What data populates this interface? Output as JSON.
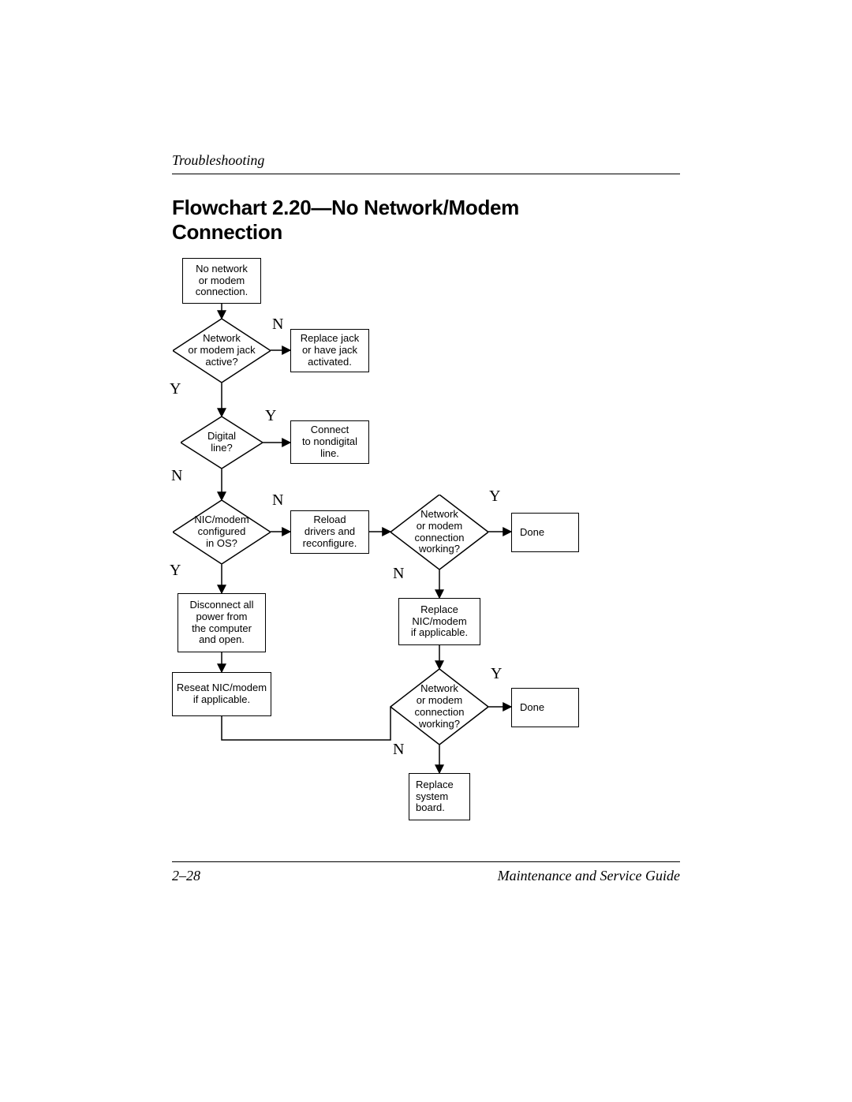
{
  "header": {
    "section": "Troubleshooting"
  },
  "title": "Flowchart 2.20—No Network/Modem Connection",
  "footer": {
    "page": "2–28",
    "book": "Maintenance and Service Guide"
  },
  "nodes": {
    "start": "No network\nor modem\nconnection.",
    "q_jack": "Network\nor modem jack\nactive?",
    "a_jack": "Replace jack\nor have jack\nactivated.",
    "q_digital": "Digital\nline?",
    "a_digital": "Connect\nto nondigital\nline.",
    "q_os": "NIC/modem\nconfigured\nin OS?",
    "a_os": "Reload\ndrivers and\nreconfigure.",
    "q_work1": "Network\nor modem\nconnection\nworking?",
    "done1": "Done",
    "disc": "Disconnect all\npower from\nthe computer\nand open.",
    "reseat": "Reseat NIC/modem\nif applicable.",
    "repl_nic": "Replace\nNIC/modem\nif applicable.",
    "q_work2": "Network\nor modem\nconnection\nworking?",
    "done2": "Done",
    "repl_sb": "Replace\nsystem\nboard."
  },
  "edge_labels": {
    "jack_N": "N",
    "jack_Y": "Y",
    "digital_Y": "Y",
    "digital_N": "N",
    "os_N": "N",
    "os_Y": "Y",
    "work1_Y": "Y",
    "work1_N": "N",
    "work2_Y": "Y",
    "work2_N": "N"
  }
}
